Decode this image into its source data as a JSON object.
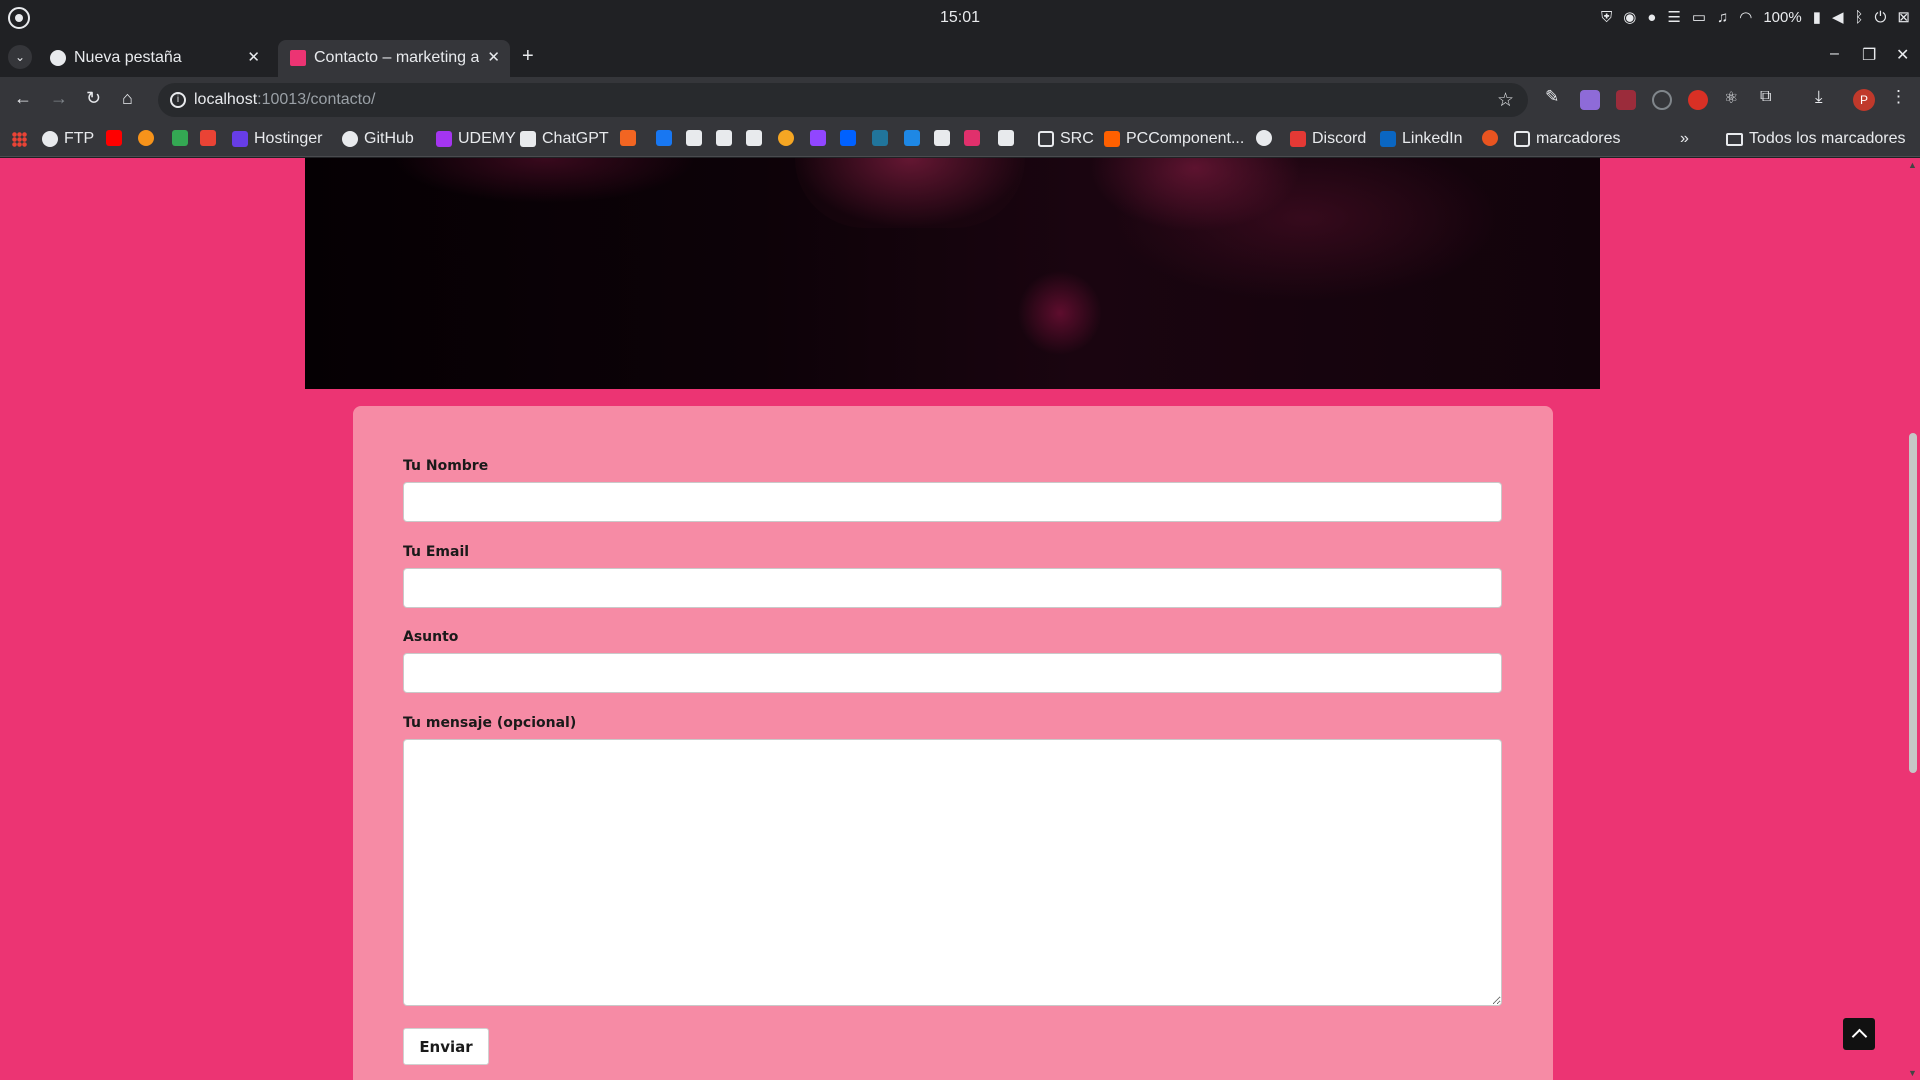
{
  "system": {
    "clock": "15:01",
    "battery": "100%"
  },
  "tabs": [
    {
      "title": "Nueva pestaña",
      "active": false,
      "favicon": "chrome-icon"
    },
    {
      "title": "Contacto – marketing a",
      "active": true,
      "favicon": "site-grid-icon"
    }
  ],
  "address_bar": {
    "host": "localhost",
    "rest": ":10013/contacto/"
  },
  "bookmarks": [
    {
      "label": "FTP",
      "icon": "globe-icon",
      "color": "#e8eaed"
    },
    {
      "label": "",
      "icon": "youtube-icon",
      "color": "#ff0000"
    },
    {
      "label": "",
      "icon": "bitcoin-icon",
      "color": "#f7931a"
    },
    {
      "label": "",
      "icon": "drive-icon",
      "color": "#34a853"
    },
    {
      "label": "",
      "icon": "gmail-icon",
      "color": "#ea4335"
    },
    {
      "label": "Hostinger",
      "icon": "hostinger-icon",
      "color": "#673de6"
    },
    {
      "label": "GitHub",
      "icon": "github-icon",
      "color": "#e8eaed"
    },
    {
      "label": "UDEMY",
      "icon": "udemy-icon",
      "color": "#a435f0"
    },
    {
      "label": "ChatGPT",
      "icon": "chatgpt-icon",
      "color": "#e8eaed"
    },
    {
      "label": "",
      "icon": "m-icon",
      "color": "#f26522"
    },
    {
      "label": "",
      "icon": "facebook-icon",
      "color": "#1877f2"
    },
    {
      "label": "",
      "icon": "hexagon-icon",
      "color": "#e8eaed"
    },
    {
      "label": "",
      "icon": "x-icon",
      "color": "#e8eaed"
    },
    {
      "label": "",
      "icon": "adobe-icon",
      "color": "#e8eaed"
    },
    {
      "label": "",
      "icon": "coin-icon",
      "color": "#f5a623"
    },
    {
      "label": "",
      "icon": "twitch-icon",
      "color": "#9146ff"
    },
    {
      "label": "",
      "icon": "dropbox-icon",
      "color": "#0061ff"
    },
    {
      "label": "",
      "icon": "wordpress-icon",
      "color": "#21759b"
    },
    {
      "label": "",
      "icon": "u-icon",
      "color": "#1e88e5"
    },
    {
      "label": "",
      "icon": "steam-icon",
      "color": "#e8eaed"
    },
    {
      "label": "",
      "icon": "instagram-icon",
      "color": "#e1306c"
    },
    {
      "label": "",
      "icon": "amazon-icon",
      "color": "#e8eaed"
    },
    {
      "label": "SRC",
      "icon": "folder-icon",
      "color": "#e8eaed"
    },
    {
      "label": "PCComponent...",
      "icon": "pccomponentes-icon",
      "color": "#ff6000"
    },
    {
      "label": "",
      "icon": "globe-icon",
      "color": "#e8eaed"
    },
    {
      "label": "Discord",
      "icon": "discord-icon",
      "color": "#e53935"
    },
    {
      "label": "LinkedIn",
      "icon": "linkedin-icon",
      "color": "#0a66c2"
    },
    {
      "label": "",
      "icon": "ubuntu-icon",
      "color": "#e95420"
    },
    {
      "label": "marcadores",
      "icon": "folder-icon",
      "color": "#e8eaed"
    }
  ],
  "bookmarks_all": "Todos los marcadores",
  "form": {
    "name_label": "Tu Nombre",
    "email_label": "Tu Email",
    "subject_label": "Asunto",
    "message_label": "Tu mensaje (opcional)",
    "name_value": "",
    "email_value": "",
    "subject_value": "",
    "message_value": "",
    "submit_label": "Enviar"
  },
  "colors": {
    "page_background": "#ec3473",
    "form_background": "#f68ba5",
    "browser_chrome": "#35363a"
  }
}
